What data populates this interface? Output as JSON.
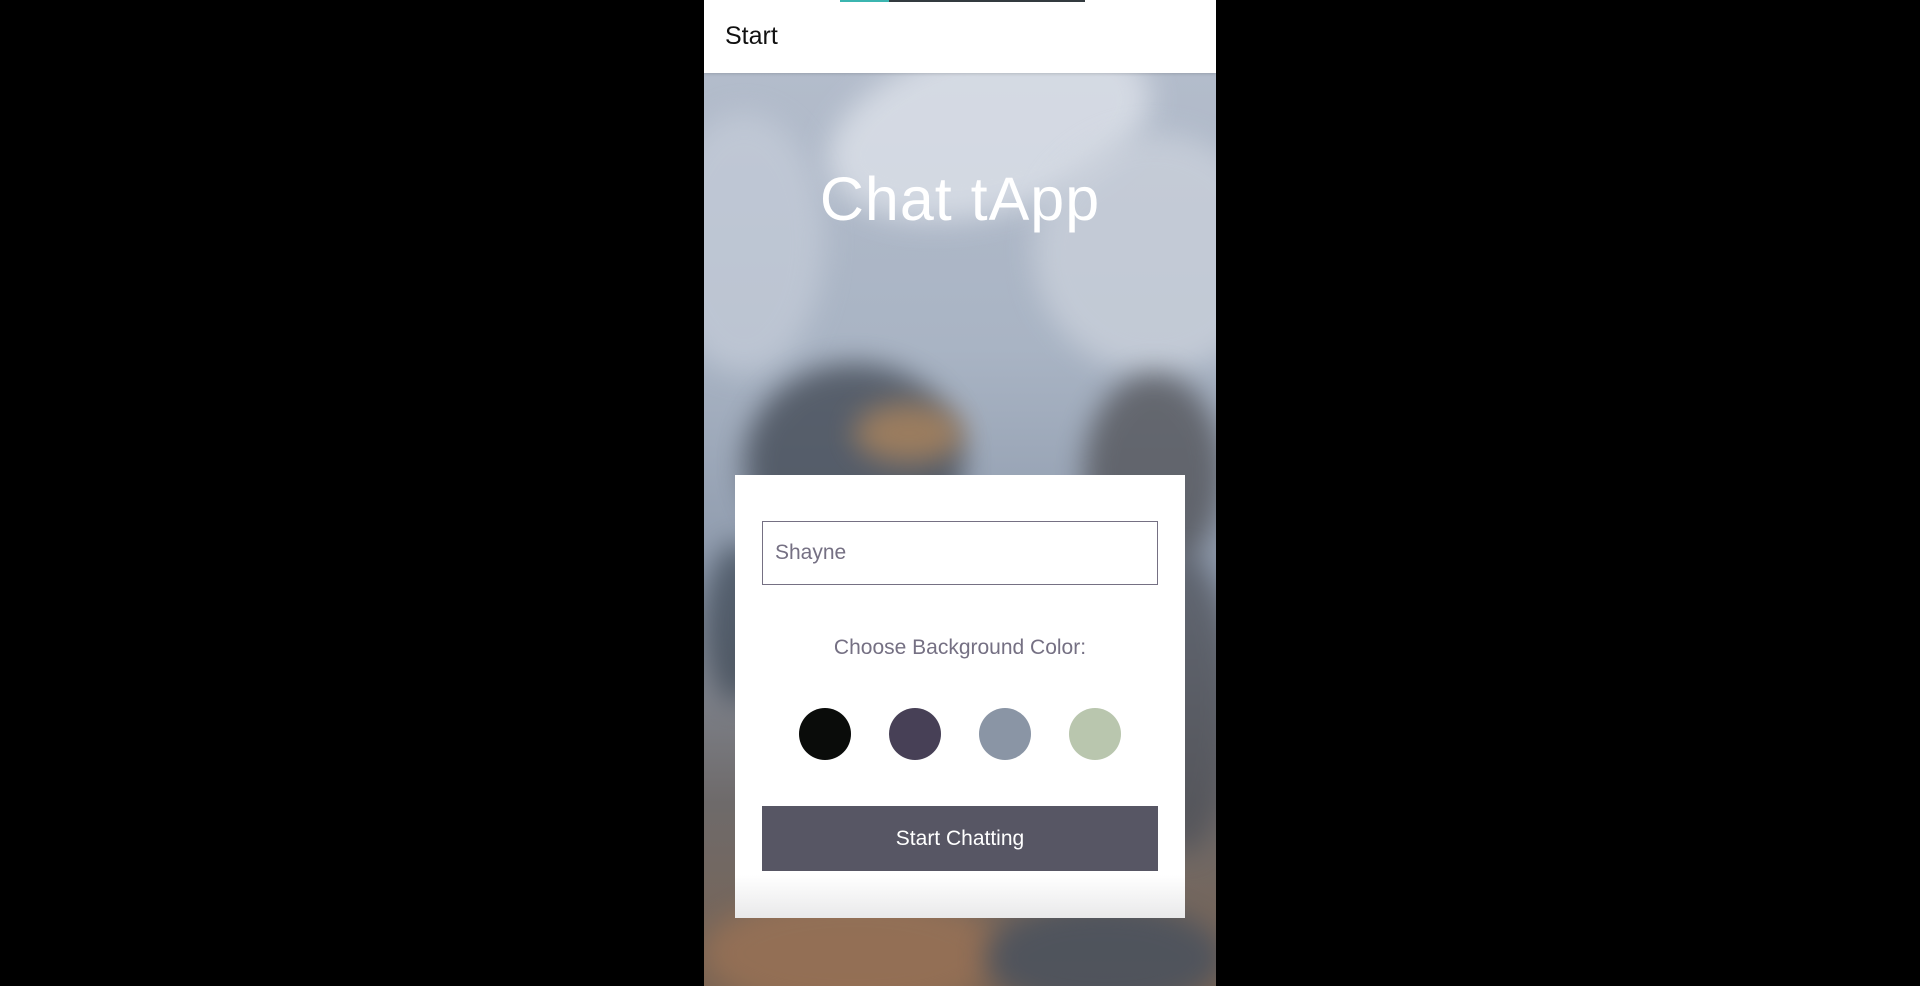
{
  "header": {
    "title": "Start"
  },
  "loading_progress": 0.2,
  "app": {
    "title": "Chat tApp"
  },
  "form": {
    "name_input": {
      "placeholder": "Shayne",
      "value": ""
    },
    "color_label": "Choose Background Color:",
    "color_options": [
      "#0a0c0a",
      "#474056",
      "#8a95a5",
      "#b9c6ae"
    ],
    "submit_label": "Start Chatting"
  },
  "colors": {
    "button_bg": "#575664",
    "muted_text": "#757083",
    "progress_accent": "#3bb5b0"
  }
}
